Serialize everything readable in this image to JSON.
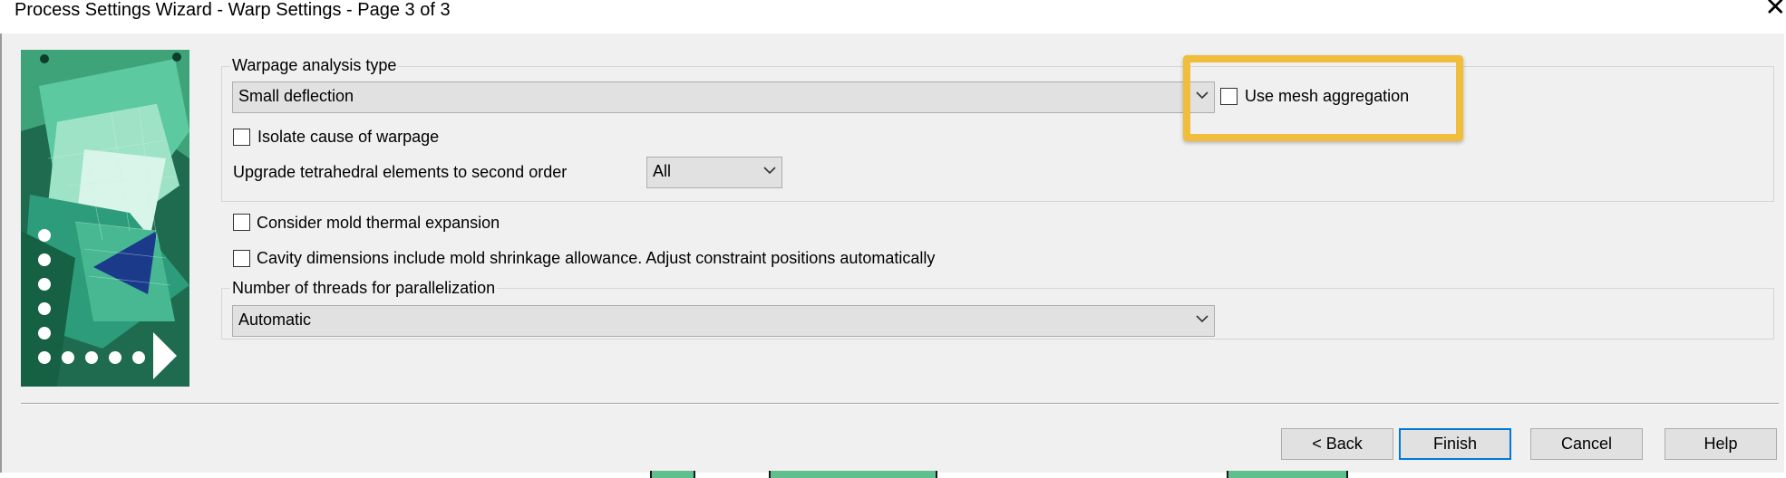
{
  "window": {
    "title": "Process Settings Wizard - Warp Settings - Page 3 of 3",
    "close_glyph": "✕"
  },
  "icons": {
    "close": "close-icon",
    "wizard_image": "wizard-illustration",
    "dropdown": "chevron-down-icon"
  },
  "colors": {
    "highlight": "#f0bd3c",
    "default_button_border": "#0078d7",
    "dialog_background": "#f0f0f0"
  },
  "warpage": {
    "group_label": "Warpage analysis type",
    "analysis_type_value": "Small deflection",
    "use_mesh_aggregation_label": "Use mesh aggregation",
    "use_mesh_aggregation_checked": false,
    "isolate_cause_label": "Isolate cause of warpage",
    "isolate_cause_checked": false,
    "upgrade_tetra_label": "Upgrade tetrahedral elements to second order",
    "upgrade_tetra_value": "All"
  },
  "options": {
    "mold_thermal_expansion_label": "Consider mold thermal expansion",
    "mold_thermal_expansion_checked": false,
    "cavity_dimensions_label": "Cavity dimensions include mold shrinkage allowance. Adjust constraint positions automatically",
    "cavity_dimensions_checked": false
  },
  "threads": {
    "group_label": "Number of threads for parallelization",
    "value": "Automatic"
  },
  "buttons": {
    "back": "< Back",
    "finish": "Finish",
    "cancel": "Cancel",
    "help": "Help"
  }
}
